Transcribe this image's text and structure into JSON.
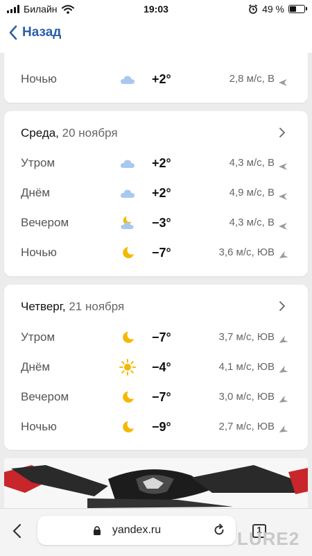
{
  "status_bar": {
    "carrier": "Билайн",
    "time": "19:03",
    "battery_percent": "49 %",
    "battery_level": 0.49
  },
  "nav": {
    "back_label": "Назад"
  },
  "prev_card": {
    "row": {
      "part": "Ночью",
      "icon": "cloud-icon",
      "temp": "+2°",
      "wind": "2,8 м/с, В"
    }
  },
  "days": [
    {
      "day": "Среда,",
      "date": "20 ноября",
      "rows": [
        {
          "part": "Утром",
          "icon": "cloud-icon",
          "temp": "+2°",
          "wind": "4,3 м/с, В"
        },
        {
          "part": "Днём",
          "icon": "cloud-icon",
          "temp": "+2°",
          "wind": "4,9 м/с, В"
        },
        {
          "part": "Вечером",
          "icon": "partly-cloudy-moon-icon",
          "temp": "−3°",
          "wind": "4,3 м/с, В"
        },
        {
          "part": "Ночью",
          "icon": "moon-icon",
          "temp": "−7°",
          "wind": "3,6 м/с, ЮВ"
        }
      ]
    },
    {
      "day": "Четверг,",
      "date": "21 ноября",
      "rows": [
        {
          "part": "Утром",
          "icon": "moon-icon",
          "temp": "−7°",
          "wind": "3,7 м/с, ЮВ"
        },
        {
          "part": "Днём",
          "icon": "sun-icon",
          "temp": "−4°",
          "wind": "4,1 м/с, ЮВ"
        },
        {
          "part": "Вечером",
          "icon": "moon-icon",
          "temp": "−7°",
          "wind": "3,0 м/с, ЮВ"
        },
        {
          "part": "Ночью",
          "icon": "moon-icon",
          "temp": "−9°",
          "wind": "2,7 м/с, ЮВ"
        }
      ]
    }
  ],
  "browser": {
    "url": "yandex.ru",
    "tab_count": "1",
    "watermark": "LURE2"
  },
  "colors": {
    "accent": "#2b5fa8",
    "cloud": "#a9c8f0",
    "sun": "#f5b800",
    "moon": "#f5b800"
  }
}
